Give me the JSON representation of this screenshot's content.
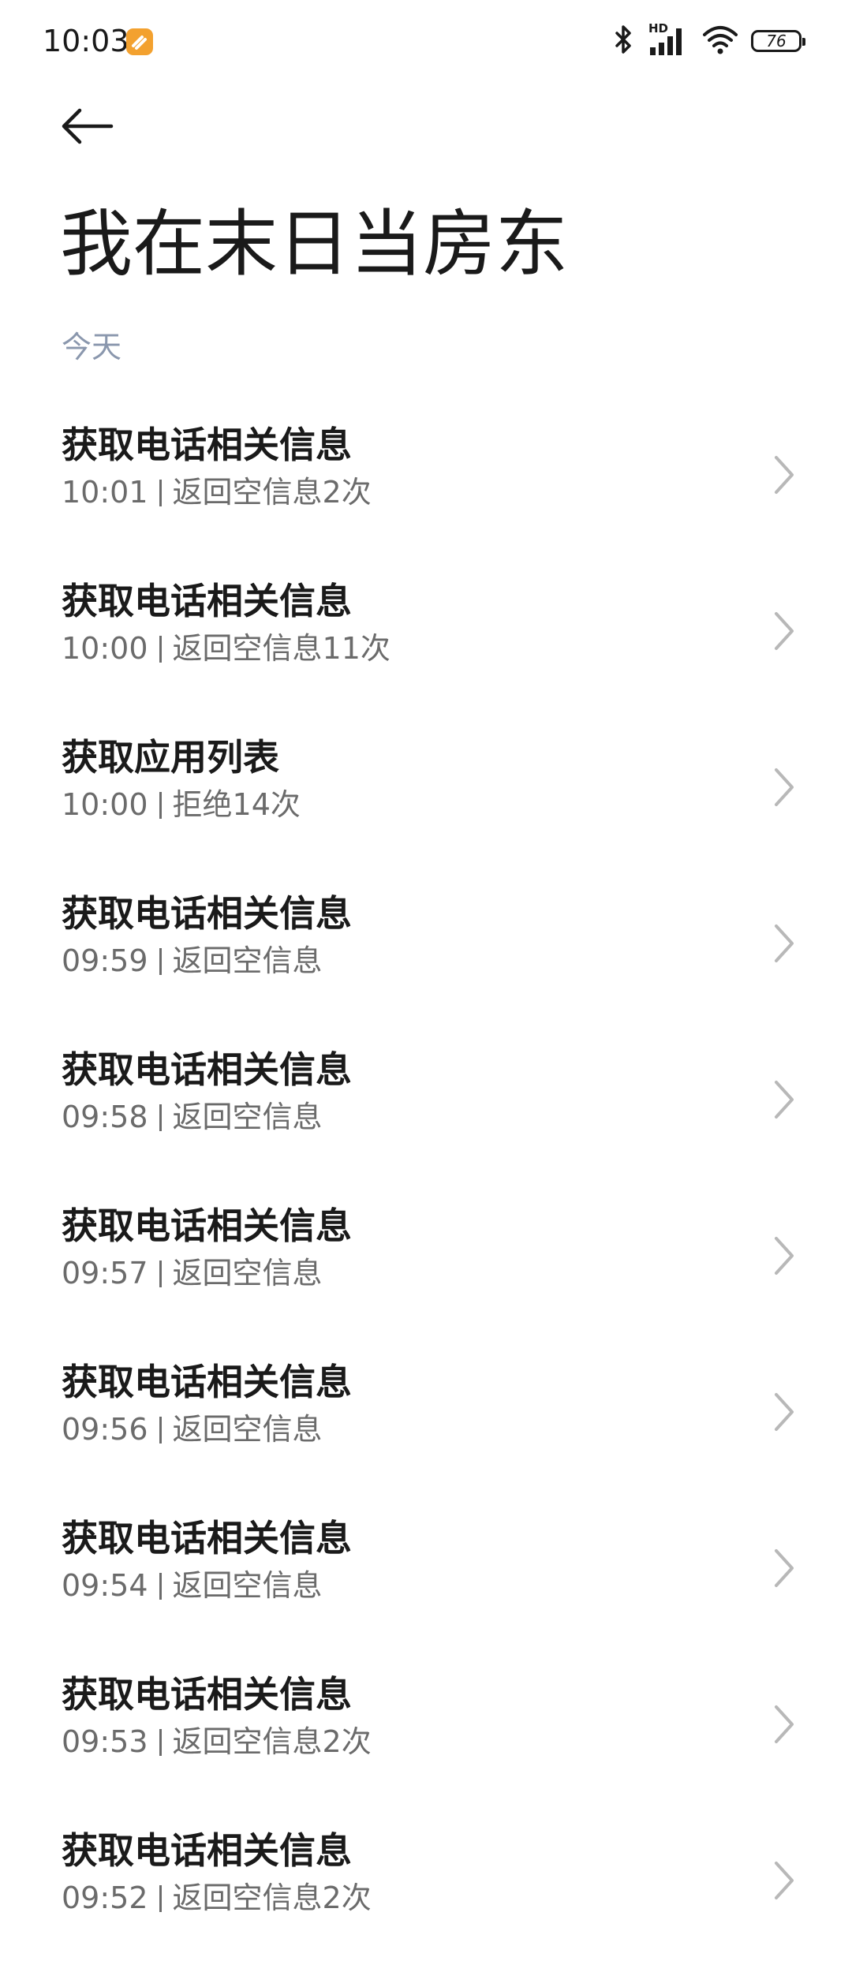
{
  "status_bar": {
    "time": "10:03",
    "battery": "76",
    "signal_label": "HD"
  },
  "header": {
    "title": "我在末日当房东"
  },
  "section": {
    "label": "今天"
  },
  "items": [
    {
      "title": "获取电话相关信息",
      "time": "10:01",
      "detail": "返回空信息2次"
    },
    {
      "title": "获取电话相关信息",
      "time": "10:00",
      "detail": "返回空信息11次"
    },
    {
      "title": "获取应用列表",
      "time": "10:00",
      "detail": "拒绝14次"
    },
    {
      "title": "获取电话相关信息",
      "time": "09:59",
      "detail": "返回空信息"
    },
    {
      "title": "获取电话相关信息",
      "time": "09:58",
      "detail": "返回空信息"
    },
    {
      "title": "获取电话相关信息",
      "time": "09:57",
      "detail": "返回空信息"
    },
    {
      "title": "获取电话相关信息",
      "time": "09:56",
      "detail": "返回空信息"
    },
    {
      "title": "获取电话相关信息",
      "time": "09:54",
      "detail": "返回空信息"
    },
    {
      "title": "获取电话相关信息",
      "time": "09:53",
      "detail": "返回空信息2次"
    },
    {
      "title": "获取电话相关信息",
      "time": "09:52",
      "detail": "返回空信息2次"
    }
  ],
  "icons": {
    "back": "arrow-left-icon",
    "chevron": "chevron-right-icon",
    "bluetooth": "bluetooth-icon",
    "signal": "cellular-signal-icon",
    "wifi": "wifi-icon",
    "battery": "battery-icon",
    "app_badge": "notification-app-icon"
  },
  "colors": {
    "section_label": "#8a97ad",
    "badge": "#f3a12f",
    "text_primary": "#1a1a1a",
    "text_secondary": "#6b6b6b"
  }
}
